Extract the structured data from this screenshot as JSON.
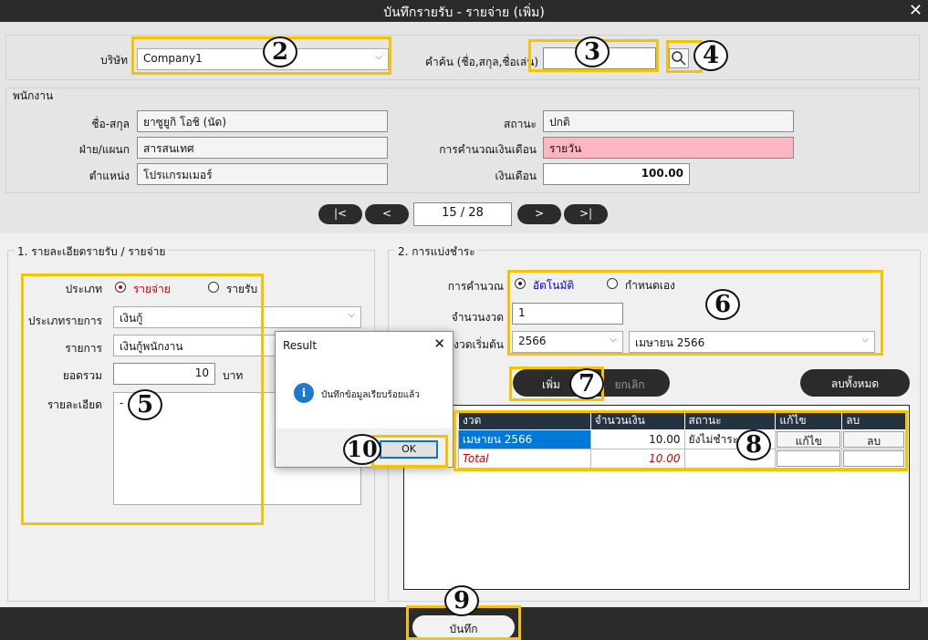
{
  "window": {
    "title": "บันทึกรายรับ - รายจ่าย (เพิ่ม)",
    "close_icon": "close-icon"
  },
  "company": {
    "label": "บริษัท",
    "value": "Company1"
  },
  "search": {
    "label": "คำค้น (ชื่อ,สกุล,ชื่อเล่น)",
    "value": "",
    "icon": "search-icon"
  },
  "employee": {
    "group_label": "พนักงาน",
    "name_label": "ชื่อ-สกุล",
    "name_value": "ยาซูยูกิ  โอชิ (นัด)",
    "dept_label": "ฝ่าย/แผนก",
    "dept_value": "สารสนเทศ",
    "position_label": "ตำแหน่ง",
    "position_value": "โปรแกรมเมอร์",
    "status_label": "สถานะ",
    "status_value": "ปกติ",
    "salary_calc_label": "การคำนวณเงินเดือน",
    "salary_calc_value": "รายวัน",
    "salary_label": "เงินเดือน",
    "salary_value": "100.00"
  },
  "pager": {
    "first": "|<",
    "prev": "<",
    "page": "15 / 28",
    "next": ">",
    "last": ">|"
  },
  "detail": {
    "group_label": "1. รายละเอียดรายรับ / รายจ่าย",
    "type_label": "ประเภท",
    "type_expense": "รายจ่าย",
    "type_income": "รายรับ",
    "trans_type_label": "ประเภทรายการ",
    "trans_type_value": "เงินกู้",
    "item_label": "รายการ",
    "item_value": "เงินกู้พนักงาน",
    "total_label": "ยอดรวม",
    "total_value": "10",
    "unit": "บาท",
    "desc_label": "รายละเอียด",
    "desc_value": "-"
  },
  "payment": {
    "group_label": "2. การแบ่งชำระ",
    "calc_label": "การคำนวณ",
    "calc_auto": "อัตโนมัติ",
    "calc_manual": "กำหนดเอง",
    "installments_label": "จำนวนงวด",
    "installments_value": "1",
    "start_label": "งวดเริ่มต้น",
    "start_year": "2566",
    "start_month": "เมษายน 2566",
    "add_label": "เพิ่ม",
    "cancel_label": "ยกเลิก",
    "delete_all_label": "ลบทั้งหมด",
    "columns": [
      "งวด",
      "จำนวนเงิน",
      "สถานะ",
      "แก้ไข",
      "ลบ"
    ],
    "rows": [
      {
        "period": "เมษายน 2566",
        "amount": "10.00",
        "status": "ยังไม่ชำระ",
        "edit": "แก้ไข",
        "del": "ลบ"
      }
    ],
    "total_label": "Total",
    "total_amount": "10.00"
  },
  "save_label": "บันทึก",
  "dialog": {
    "title": "Result",
    "message": "บันทึกข้อมูลเรียบร้อยแล้ว",
    "ok": "OK",
    "icon": "info-icon",
    "close_icon": "close-icon"
  },
  "badges": {
    "b2": "2",
    "b3": "3",
    "b4": "4",
    "b5": "5",
    "b6": "6",
    "b7": "7",
    "b8": "8",
    "b9": "9",
    "b10": "10"
  },
  "colors": {
    "annotation": "#f5c400",
    "pink": "#ffb6c1",
    "header": "#253340",
    "dark": "#2b2b2b",
    "selected": "#0078d7"
  }
}
